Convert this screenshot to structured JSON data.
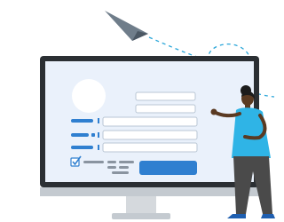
{
  "palette": {
    "monitor_frame": "#2b2f33",
    "screen_bg": "#eaf1fb",
    "accent_blue": "#2f7fd0",
    "field_border": "#b9c6d4",
    "stand": "#d5d9dd",
    "person_top": "#2fb4e6",
    "person_pants": "#4a4a4a",
    "person_skin": "#5a3a22",
    "plane": "#6f7d8a",
    "dashed_path": "#2aa6d9"
  },
  "form": {
    "rows": 3,
    "checkbox_checked": true
  }
}
